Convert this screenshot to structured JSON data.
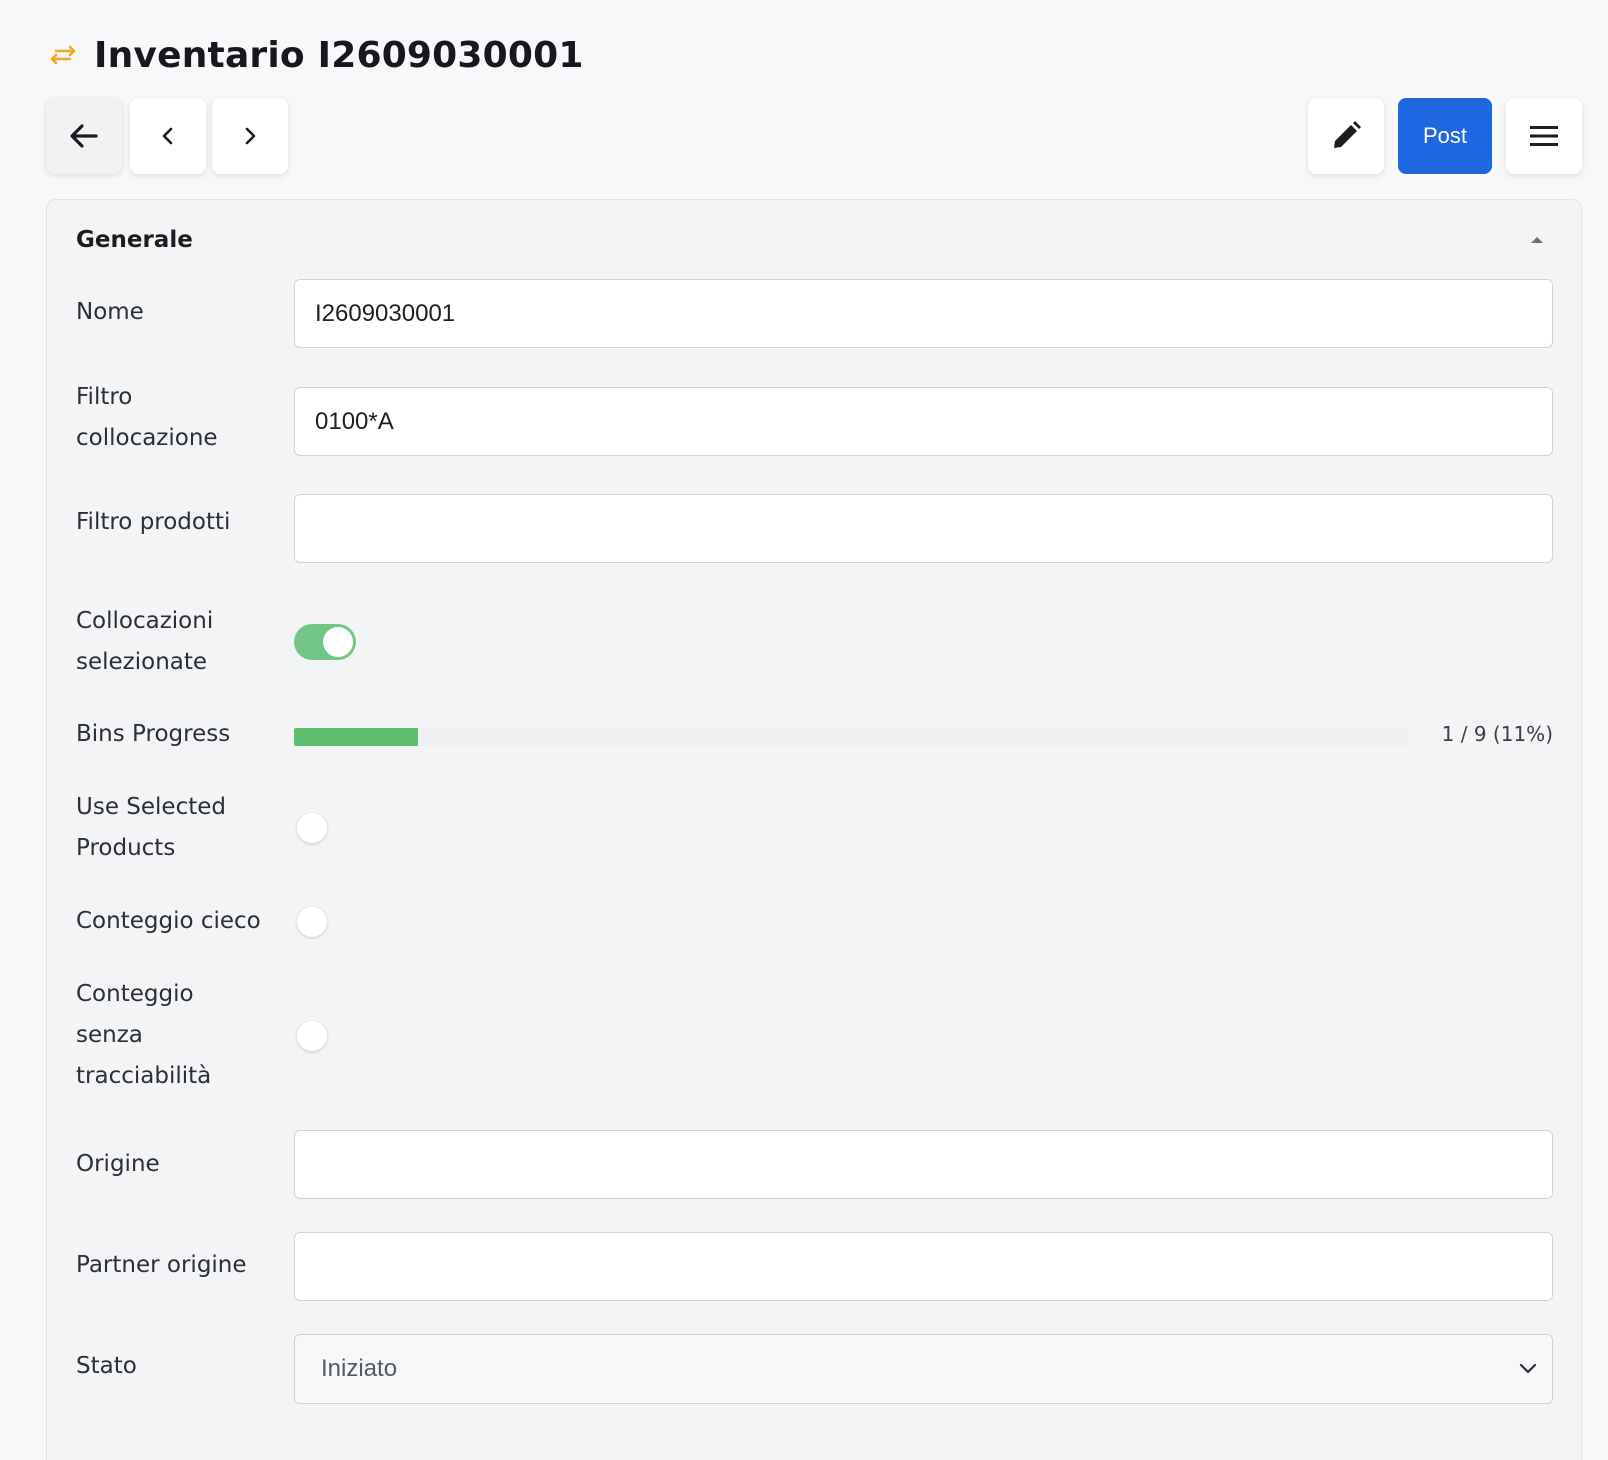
{
  "header": {
    "title": "Inventario I2609030001",
    "icon": "transfer-arrows-icon",
    "icon_color": "#f5a623"
  },
  "toolbar": {
    "back_icon": "arrow-left-icon",
    "prev_icon": "chevron-left-icon",
    "next_icon": "chevron-right-icon",
    "edit_icon": "pencil-icon",
    "post_label": "Post",
    "post_color": "#1f67e0",
    "menu_icon": "hamburger-menu-icon"
  },
  "section": {
    "title": "Generale",
    "collapse_icon": "caret-up-icon"
  },
  "fields": {
    "nome": {
      "label": "Nome",
      "value": "I2609030001"
    },
    "filtro_collocazione": {
      "label": "Filtro collocazione",
      "value": "0100*A"
    },
    "filtro_prodotti": {
      "label": "Filtro prodotti",
      "value": ""
    },
    "collocazioni_selezionate": {
      "label": "Collocazioni selezionate",
      "checked": true
    },
    "bins_progress": {
      "label": "Bins Progress",
      "done": 1,
      "total": 9,
      "percent": 11,
      "text": "1 / 9 (11%)",
      "fill_color": "#5cbf6e"
    },
    "use_selected_products": {
      "label": "Use Selected Products",
      "checked": false
    },
    "conteggio_cieco": {
      "label": "Conteggio cieco",
      "checked": false
    },
    "conteggio_senza_tracciabilita": {
      "label": "Conteggio senza tracciabilità",
      "checked": false
    },
    "origine": {
      "label": "Origine",
      "value": ""
    },
    "partner_origine": {
      "label": "Partner origine",
      "value": ""
    },
    "stato": {
      "label": "Stato",
      "value": "Iniziato"
    }
  }
}
